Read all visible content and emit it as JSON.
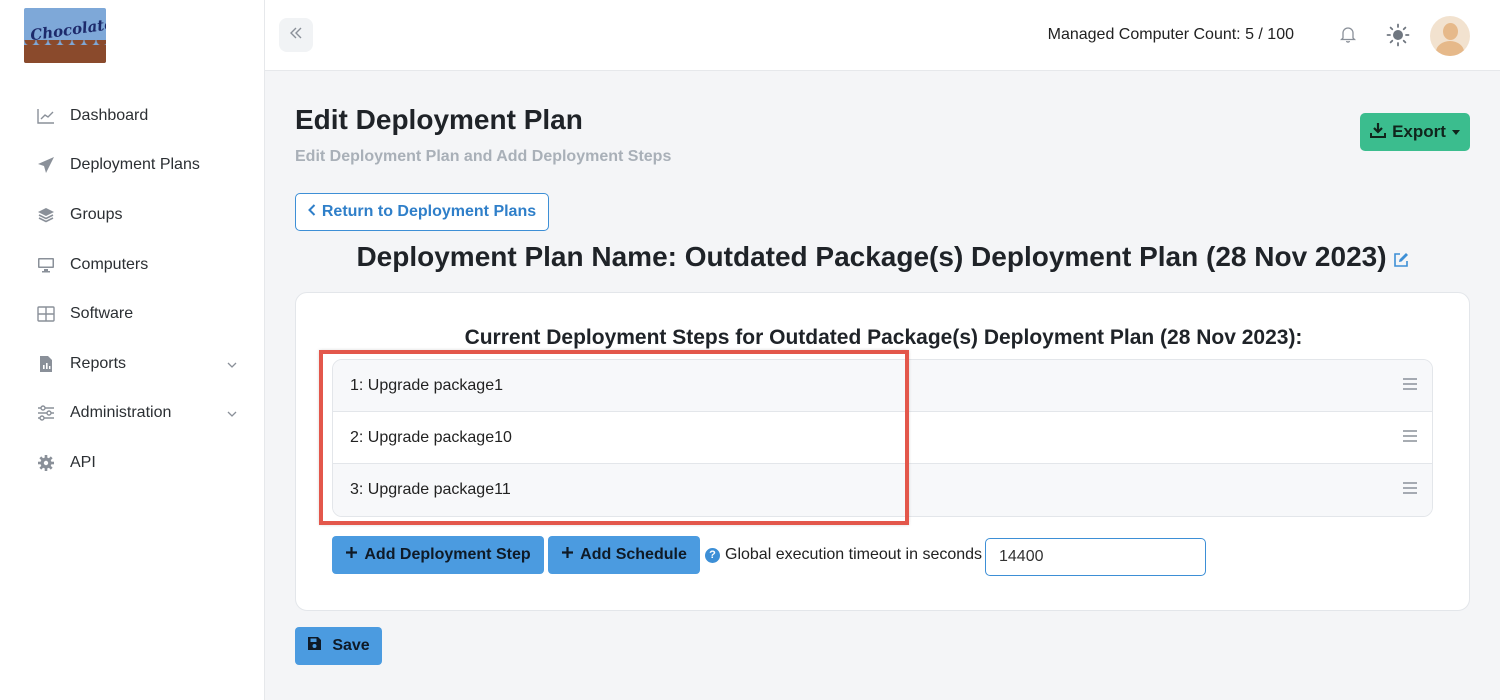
{
  "sidebar": {
    "logo_text": "Chocolatey",
    "items": [
      {
        "label": "Dashboard",
        "icon": "chart-line-icon"
      },
      {
        "label": "Deployment Plans",
        "icon": "paper-plane-icon"
      },
      {
        "label": "Groups",
        "icon": "layers-icon"
      },
      {
        "label": "Computers",
        "icon": "monitor-icon"
      },
      {
        "label": "Software",
        "icon": "grid-icon"
      },
      {
        "label": "Reports",
        "icon": "file-chart-icon",
        "expandable": true
      },
      {
        "label": "Administration",
        "icon": "sliders-icon",
        "expandable": true
      },
      {
        "label": "API",
        "icon": "gear-icon"
      }
    ]
  },
  "topbar": {
    "managed_count": "Managed Computer Count: 5 / 100"
  },
  "page": {
    "title": "Edit Deployment Plan",
    "subtitle": "Edit Deployment Plan and Add Deployment Steps",
    "export_label": "Export",
    "return_label": "Return to Deployment Plans",
    "plan_name": "Deployment Plan Name: Outdated Package(s) Deployment Plan (28 Nov 2023)"
  },
  "steps_card": {
    "title": "Current Deployment Steps for Outdated Package(s) Deployment Plan (28 Nov 2023):",
    "steps": [
      "1: Upgrade package1",
      "2: Upgrade package10",
      "3: Upgrade package11"
    ],
    "add_step_label": "Add Deployment Step",
    "add_schedule_label": "Add Schedule",
    "timeout_label": "Global execution timeout in seconds",
    "timeout_value": "14400"
  },
  "save_label": "Save",
  "colors": {
    "accent_blue": "#4b9be0",
    "export_green": "#3bbd8e",
    "highlight_red": "#e3574b"
  }
}
